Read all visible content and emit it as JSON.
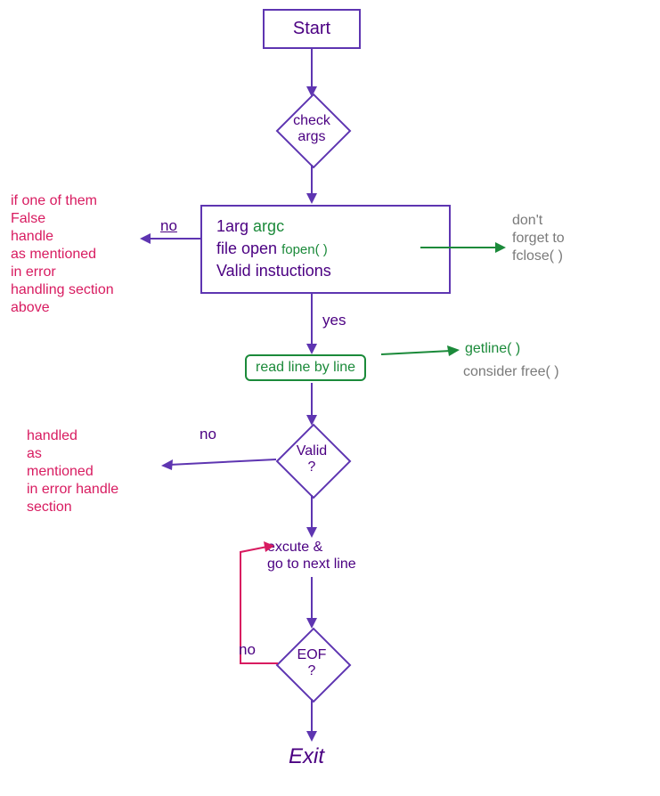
{
  "flowchart": {
    "nodes": {
      "start": {
        "label": "Start",
        "type": "terminal"
      },
      "check_args": {
        "label": "check\nargs",
        "type": "decision"
      },
      "process": {
        "line1_left": "1arg",
        "line1_right": "argc",
        "line2_left": "file open",
        "line2_right": "fopen( )",
        "line3": "Valid instuctions",
        "type": "process"
      },
      "readline": {
        "label": "read line by line",
        "type": "subprocess"
      },
      "valid": {
        "label": "Valid\n?",
        "type": "decision"
      },
      "execute": {
        "label": "excute &\ngo to next line",
        "type": "action"
      },
      "eof": {
        "label": "EOF\n?",
        "type": "decision"
      },
      "exit": {
        "label": "Exit",
        "type": "terminal"
      }
    },
    "edges": {
      "process_no": "no",
      "process_yes": "yes",
      "valid_no": "no",
      "eof_no": "no"
    },
    "annotations": {
      "error_top": "if one of them\nFalse\nhandle\nas mentioned\nin error\nhandling section\nabove",
      "fclose_note": "don't\nforget to\nfclose( )",
      "getline_note": "getline( )",
      "free_note": "consider free( )",
      "error_valid": "handled\nas\nmentioned\nin error handle\nsection"
    }
  }
}
